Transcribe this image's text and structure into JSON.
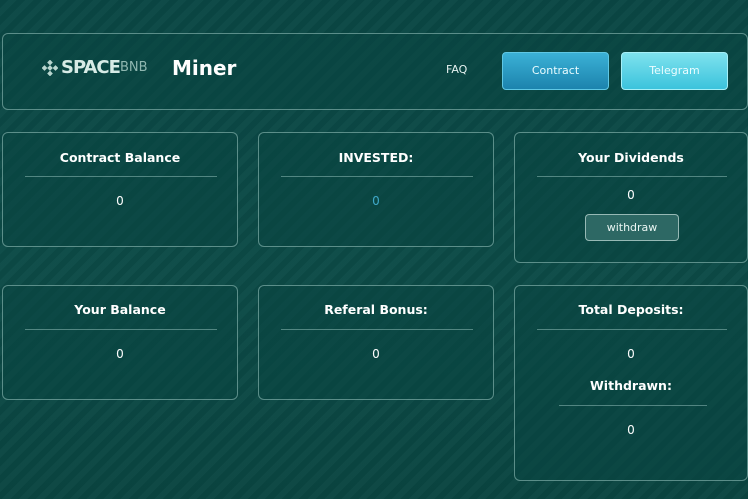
{
  "header": {
    "logo_text": "SPACE",
    "logo_sub": "BNB",
    "title": "Miner",
    "faq_label": "FAQ",
    "contract_label": "Contract",
    "telegram_label": "Telegram"
  },
  "cards": {
    "contract_balance": {
      "title": "Contract Balance",
      "value": "0"
    },
    "invested": {
      "title": "INVESTED:",
      "value": "0"
    },
    "dividends": {
      "title": "Your Dividends",
      "value": "0",
      "button": "withdraw"
    },
    "your_balance": {
      "title": "Your Balance",
      "value": "0"
    },
    "referal_bonus": {
      "title": "Referal Bonus:",
      "value": "0"
    },
    "total_deposits": {
      "title": "Total Deposits:",
      "value": "0"
    },
    "withdrawn": {
      "title": "Withdrawn:",
      "value": "0"
    }
  },
  "colors": {
    "background": "#0b4845",
    "contract_button": "#1c83ad",
    "telegram_button": "#3bc3dc",
    "invested_value": "#3fa9c9"
  }
}
